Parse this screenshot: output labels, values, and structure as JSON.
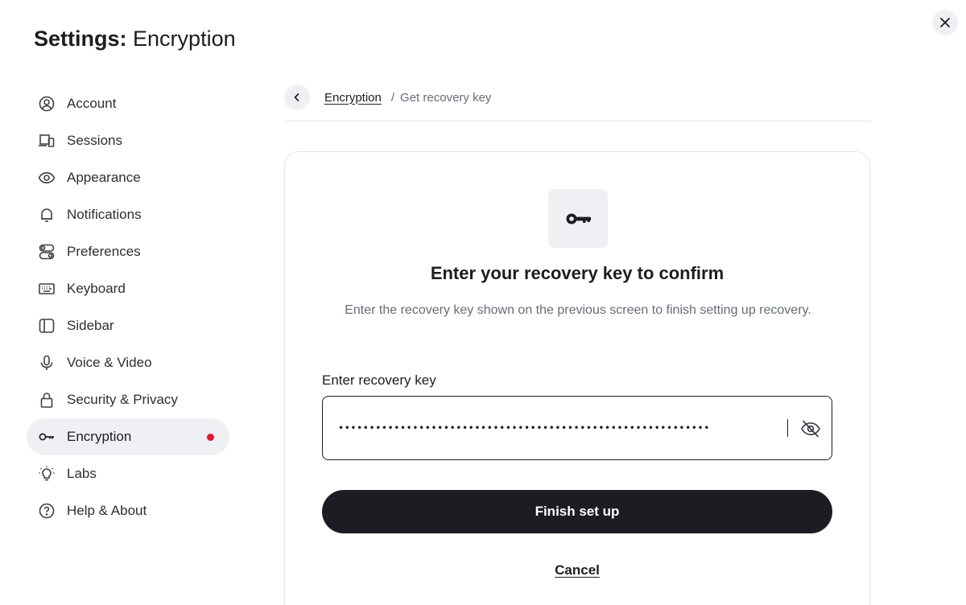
{
  "dialog": {
    "title_prefix": "Settings:",
    "title_section": "Encryption",
    "close_icon": "close-icon"
  },
  "sidebar": {
    "items": [
      {
        "label": "Account",
        "icon": "user-circle-icon"
      },
      {
        "label": "Sessions",
        "icon": "devices-icon"
      },
      {
        "label": "Appearance",
        "icon": "eye-icon"
      },
      {
        "label": "Notifications",
        "icon": "bell-icon"
      },
      {
        "label": "Preferences",
        "icon": "toggles-icon"
      },
      {
        "label": "Keyboard",
        "icon": "keyboard-icon"
      },
      {
        "label": "Sidebar",
        "icon": "sidebar-icon"
      },
      {
        "label": "Voice & Video",
        "icon": "microphone-icon"
      },
      {
        "label": "Security & Privacy",
        "icon": "lock-icon"
      },
      {
        "label": "Encryption",
        "icon": "key-icon",
        "active": true,
        "has_dot": true
      },
      {
        "label": "Labs",
        "icon": "lightbulb-icon"
      },
      {
        "label": "Help & About",
        "icon": "help-icon"
      }
    ]
  },
  "breadcrumb": {
    "parent": "Encryption",
    "separator": "/",
    "current": "Get recovery key"
  },
  "card": {
    "badge_icon": "key-icon",
    "heading": "Enter your recovery key to confirm",
    "description": "Enter the recovery key shown on the previous screen to finish setting up recovery.",
    "field_label": "Enter recovery key",
    "field_value_masked": "••••••••••••••••••••••••••••••••••••••••••••••••••••••••••••",
    "visibility_icon": "eye-off-icon",
    "primary_button": "Finish set up",
    "cancel_link": "Cancel"
  },
  "colors": {
    "text_primary": "#1b1d22",
    "text_secondary": "#656d77",
    "surface_subtle": "#eef0f4",
    "border": "#e1e4e8",
    "notification_dot": "#e0172c",
    "button_bg": "#1b1d22"
  }
}
